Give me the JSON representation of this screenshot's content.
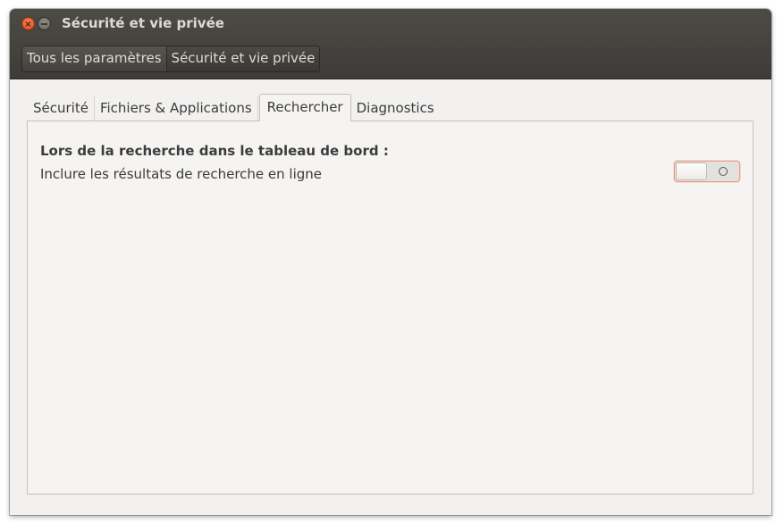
{
  "window": {
    "title": "Sécurité et vie privée",
    "close_icon": "close-icon",
    "minimize_icon": "minimize-icon"
  },
  "breadcrumb": {
    "items": [
      {
        "label": "Tous les paramètres"
      },
      {
        "label": "Sécurité et vie privée"
      }
    ]
  },
  "tabs": [
    {
      "label": "Sécurité",
      "selected": false
    },
    {
      "label": "Fichiers & Applications",
      "selected": false
    },
    {
      "label": "Rechercher",
      "selected": true
    },
    {
      "label": "Diagnostics",
      "selected": false
    }
  ],
  "search_panel": {
    "heading": "Lors de la recherche dans le tableau de bord :",
    "option_label": "Inclure les résultats de recherche en ligne",
    "online_results_enabled": false
  },
  "colors": {
    "header_bg": "#3d3c38",
    "close_button": "#df4a16",
    "focus_accent": "#e89a82",
    "window_bg": "#f2f1f0"
  }
}
